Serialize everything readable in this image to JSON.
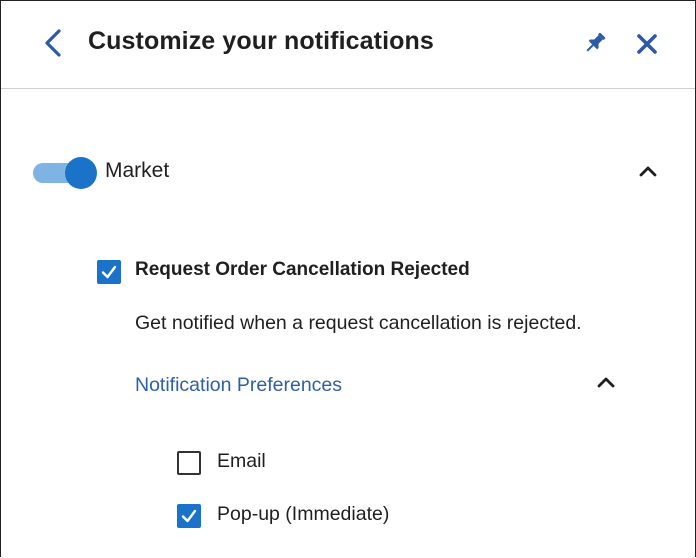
{
  "header": {
    "title": "Customize your notifications",
    "back_icon": "chevron-left-icon",
    "pin_icon": "pin-icon",
    "close_icon": "close-icon"
  },
  "section": {
    "label": "Market",
    "toggle_on": true,
    "expanded": true
  },
  "notification": {
    "title": "Request Order Cancellation Rejected",
    "description": "Get notified when a request cancellation is rejected.",
    "checked": true
  },
  "preferences": {
    "label": "Notification Preferences",
    "expanded": true,
    "options": [
      {
        "label": "Email",
        "checked": false
      },
      {
        "label": "Pop-up (Immediate)",
        "checked": true
      }
    ]
  },
  "colors": {
    "accent": "#1a73c9",
    "toggle_track": "#7fb3e3",
    "link": "#2d5faa",
    "icon": "#2b5aa8",
    "divider": "#cfcfcf"
  }
}
